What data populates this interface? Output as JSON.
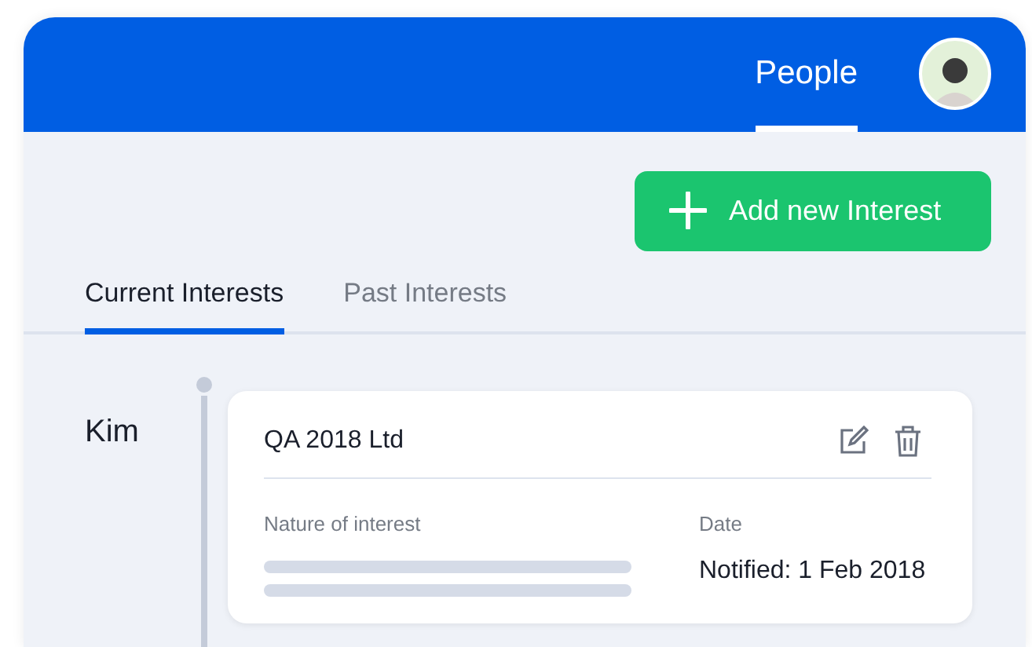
{
  "header": {
    "nav": [
      {
        "label": "People",
        "selected": true
      }
    ]
  },
  "add_button": {
    "label": "Add new Interest"
  },
  "tabs": [
    {
      "label": "Current Interests",
      "selected": true
    },
    {
      "label": "Past Interests",
      "selected": false
    }
  ],
  "entries": [
    {
      "person": "Kim",
      "card": {
        "title": "QA 2018 Ltd",
        "fields": [
          {
            "kind": "skeleton",
            "label": "Nature of interest"
          },
          {
            "kind": "text",
            "label": "Date",
            "value": "Notified: 1 Feb 2018"
          }
        ]
      }
    }
  ]
}
